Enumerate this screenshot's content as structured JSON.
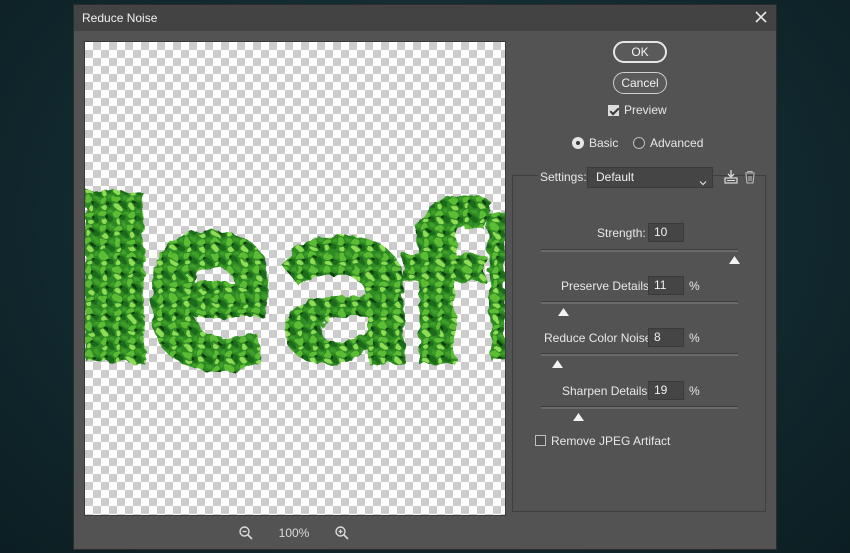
{
  "dialog": {
    "title": "Reduce Noise"
  },
  "preview": {
    "zoom": "100%"
  },
  "buttons": {
    "ok": "OK",
    "cancel": "Cancel"
  },
  "preview_checkbox": {
    "label": "Preview",
    "checked": true
  },
  "mode": {
    "basic": "Basic",
    "advanced": "Advanced",
    "selected": "Basic"
  },
  "settings": {
    "label": "Settings:",
    "value": "Default"
  },
  "sliders": [
    {
      "label": "Strength:",
      "value": "10",
      "unit": "",
      "level": 0.98
    },
    {
      "label": "Preserve Details:",
      "value": "11",
      "unit": "%",
      "level": 0.11
    },
    {
      "label": "Reduce Color Noise:",
      "value": "8",
      "unit": "%",
      "level": 0.08
    },
    {
      "label": "Sharpen Details:",
      "value": "19",
      "unit": "%",
      "level": 0.19
    }
  ],
  "jpeg_artifact": {
    "label": "Remove JPEG Artifact",
    "checked": false
  },
  "colors": {
    "dialog_bg": "#535353",
    "titlebar_bg": "#434343",
    "leaf_dark": "#1f6b1a",
    "leaf_light": "#7fd24a"
  }
}
